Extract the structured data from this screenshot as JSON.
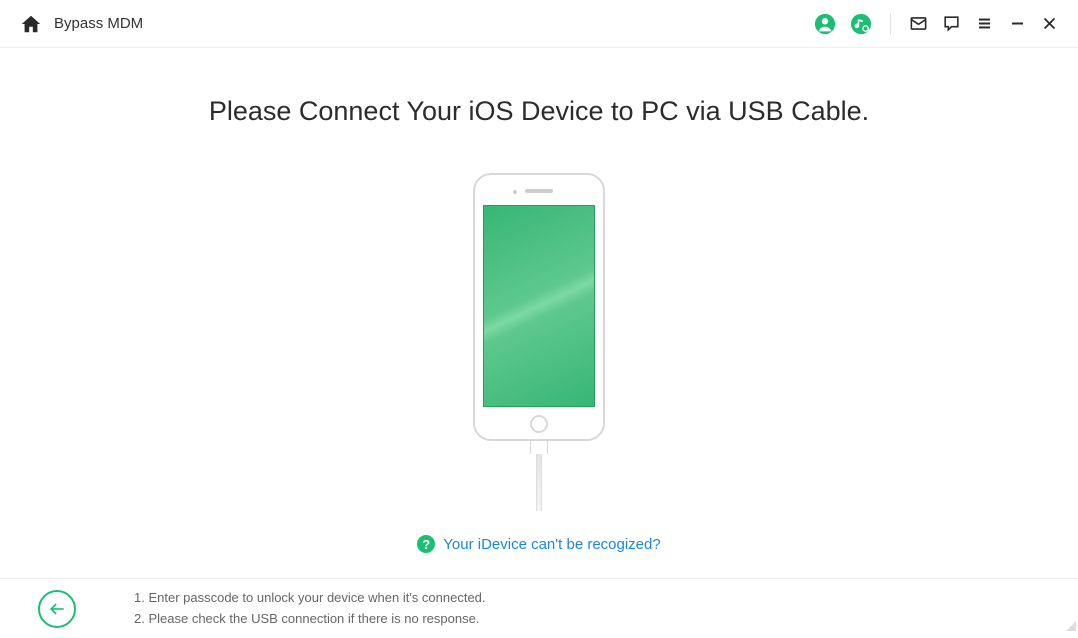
{
  "header": {
    "title": "Bypass MDM"
  },
  "main": {
    "heading": "Please Connect Your iOS Device to PC via USB Cable.",
    "help_link": "Your iDevice can't be recogized?"
  },
  "footer": {
    "tip1": "1. Enter passcode to unlock your device when it's connected.",
    "tip2": "2. Please check the USB connection if there is no response."
  },
  "colors": {
    "accent": "#1bbf73",
    "link": "#1989d8"
  }
}
